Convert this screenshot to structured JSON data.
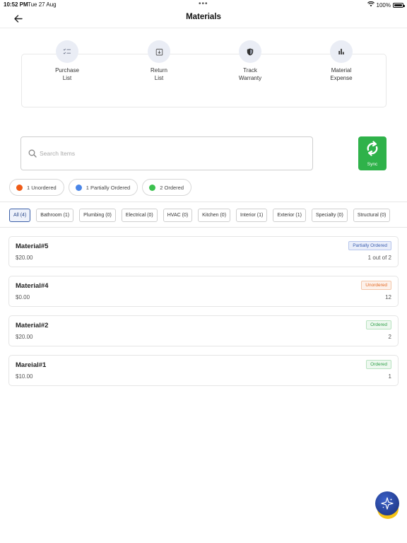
{
  "status_bar": {
    "time": "10:52 PM",
    "date": "Tue 27 Aug",
    "battery": "100%",
    "dots": "•••"
  },
  "nav": {
    "title": "Materials",
    "back_icon": "arrow-left-icon"
  },
  "actions": [
    {
      "label": "Purchase\nList",
      "icon": "checklist-icon"
    },
    {
      "label": "Return\nList",
      "icon": "return-box-icon"
    },
    {
      "label": "Track\nWarranty",
      "icon": "shield-icon"
    },
    {
      "label": "Material\nExpense",
      "icon": "bar-chart-icon"
    }
  ],
  "search": {
    "placeholder": "Search Items",
    "value": ""
  },
  "sync": {
    "label": "Sync",
    "color": "#2fb24a"
  },
  "status_pills": [
    {
      "label": "1 Unordered",
      "color": "#ef5b17"
    },
    {
      "label": "1 Partially Ordered",
      "color": "#4a86e8"
    },
    {
      "label": "2 Ordered",
      "color": "#3cc14f"
    }
  ],
  "filters": [
    {
      "label": "All (4)",
      "active": true
    },
    {
      "label": "Bathroom (1)"
    },
    {
      "label": "Plumbing (0)"
    },
    {
      "label": "Electrical (0)"
    },
    {
      "label": "HVAC (0)"
    },
    {
      "label": "Kitchen (0)"
    },
    {
      "label": "Interior (1)"
    },
    {
      "label": "Exterior (1)"
    },
    {
      "label": "Specialty (0)"
    },
    {
      "label": "Structural (0)"
    }
  ],
  "items": [
    {
      "name": "Material#5",
      "price": "$20.00",
      "status": "Partially Ordered",
      "status_type": "partial",
      "qty": "1 out of 2"
    },
    {
      "name": "Material#4",
      "price": "$0.00",
      "status": "Unordered",
      "status_type": "unordered",
      "qty": "12"
    },
    {
      "name": "Material#2",
      "price": "$20.00",
      "status": "Ordered",
      "status_type": "ordered",
      "qty": "2"
    },
    {
      "name": "Mareial#1",
      "price": "$10.00",
      "status": "Ordered",
      "status_type": "ordered",
      "qty": "1"
    }
  ],
  "fab": {
    "icon": "sparkle-assistant-icon"
  }
}
